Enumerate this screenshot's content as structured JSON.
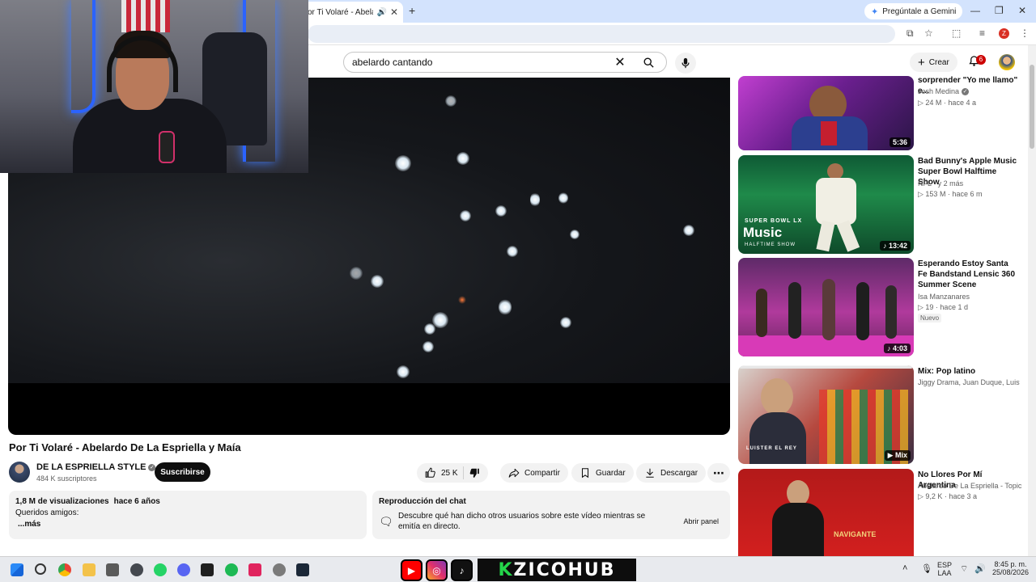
{
  "browser": {
    "tab_title": "or Ti Volaré - Abelardo",
    "gemini_label": "Pregúntale a Gemini",
    "profile_badge": "Z"
  },
  "header": {
    "search_value": "abelardo cantando",
    "create_label": "Crear",
    "notifications_count": "6"
  },
  "video": {
    "title": "Por Ti Volaré - Abelardo De La Espriella y Maía",
    "channel": "DE LA ESPRIELLA STYLE",
    "subscribers": "484 K suscriptores",
    "subscribe_label": "Suscribirse",
    "likes": "25 K",
    "share_label": "Compartir",
    "save_label": "Guardar",
    "download_label": "Descargar"
  },
  "description": {
    "views": "1,8 M de visualizaciones",
    "age": "hace 6 años",
    "text": "Queridos amigos:",
    "more": "...más"
  },
  "chat": {
    "title": "Reproducción del chat",
    "text": "Descubre qué han dicho otros usuarios sobre este vídeo mientras se emitía en directo.",
    "button": "Abrir panel"
  },
  "recommendations": [
    {
      "title": "sorprender \"Yo me llamo\" e...",
      "channel": "Josh Medina",
      "meta": "24 M · hace 4 a",
      "duration": "5:36",
      "badge": ""
    },
    {
      "title": "Bad Bunny's Apple Music Super Bowl Halftime Show",
      "channel": "NFL · y 2 más",
      "meta": "153 M · hace 6 m",
      "duration": "13:42",
      "badge": ""
    },
    {
      "title": "Esperando Estoy Santa Fe Bandstand Lensic 360 Summer Scene",
      "channel": "Isa Manzanares",
      "meta": "19 · hace 1 d",
      "duration": "4:03",
      "badge": "Nuevo"
    },
    {
      "title": "Mix: Pop latino",
      "channel": "Jiggy Drama, Juan Duque, Luister...",
      "meta": "",
      "duration": "Mix",
      "badge": ""
    },
    {
      "title": "No Llores Por Mí Argentina",
      "channel": "Abelardo De La Espriella - Topic",
      "meta": "9,2 K · hace 3 a",
      "duration": "",
      "badge": ""
    }
  ],
  "thumb_texts": {
    "super_bowl": "SUPER BOWL LX",
    "music": "Music",
    "halftime": "HALFTIME SHOW",
    "luister": "LUISTER EL REY",
    "navigante": "NAVIGANTE"
  },
  "taskbar": {
    "brand": "ZICOHUB",
    "lang": "ESP",
    "lang2": "LAA",
    "time": "8:45 p. m.",
    "date": "25/08/2026"
  }
}
